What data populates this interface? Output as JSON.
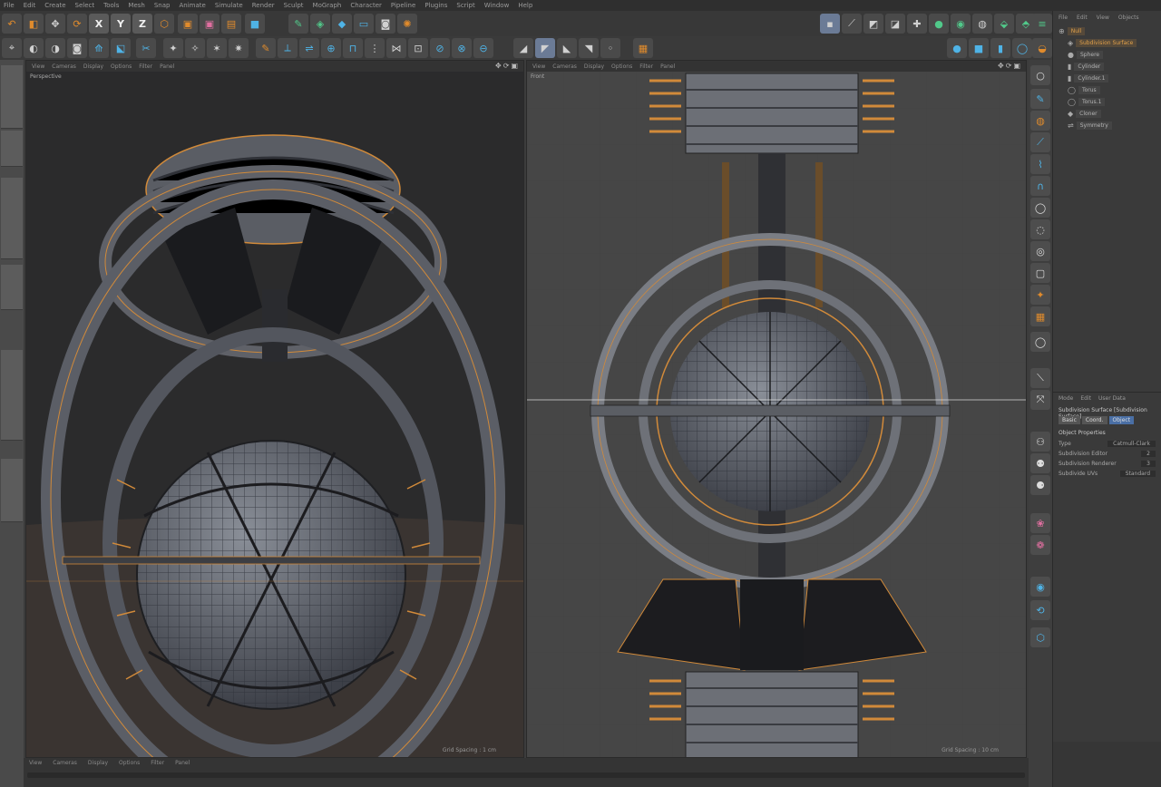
{
  "menus": [
    "File",
    "Edit",
    "Create",
    "Select",
    "Tools",
    "Mesh",
    "Snap",
    "Animate",
    "Simulate",
    "Render",
    "Sculpt",
    "MoGraph",
    "Character",
    "Pipeline",
    "Plugins",
    "Script",
    "Window",
    "Help"
  ],
  "axis_buttons": [
    "X",
    "Y",
    "Z"
  ],
  "viewports": {
    "perspective": {
      "title": "Perspective",
      "menu": [
        "View",
        "Cameras",
        "Display",
        "Options",
        "Filter",
        "Panel"
      ],
      "footer": "Grid Spacing : 1 cm"
    },
    "front": {
      "title": "Front",
      "menu": [
        "View",
        "Cameras",
        "Display",
        "Options",
        "Filter",
        "Panel"
      ],
      "footer": "Grid Spacing : 10 cm"
    }
  },
  "timeline": {
    "labels": [
      "View",
      "Cameras",
      "Display",
      "Options",
      "Filter",
      "Panel"
    ]
  },
  "object_manager": {
    "tabs": [
      "File",
      "Edit",
      "View",
      "Objects"
    ],
    "items": [
      "Null",
      "Subdivision Surface",
      "Sphere",
      "Cylinder",
      "Cylinder.1",
      "Torus",
      "Torus.1",
      "Cloner",
      "Symmetry"
    ]
  },
  "attribute_manager": {
    "tabs": [
      "Mode",
      "Edit",
      "User Data"
    ],
    "header": "Subdivision Surface [Subdivision Surface]",
    "buttons": [
      "Basic",
      "Coord.",
      "Object"
    ],
    "section": "Object Properties",
    "rows": [
      {
        "label": "Type",
        "value": "Catmull-Clark"
      },
      {
        "label": "Subdivision Editor",
        "value": "2"
      },
      {
        "label": "Subdivision Renderer",
        "value": "3"
      },
      {
        "label": "Subdivide UVs",
        "value": "Standard"
      }
    ]
  },
  "colors": {
    "accent_orange": "#e08b2c",
    "selection_blue": "#4a6fa5"
  }
}
